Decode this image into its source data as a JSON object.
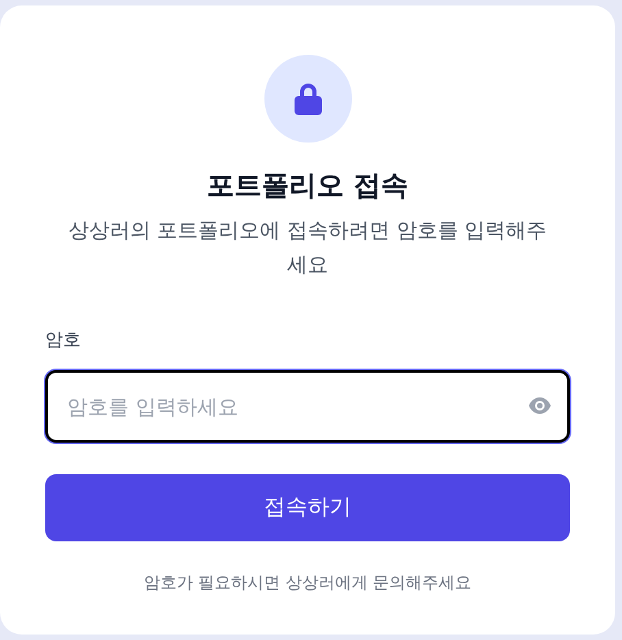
{
  "title": "포트폴리오 접속",
  "subtitle": "상상러의 포트폴리오에 접속하려면 암호를 입력해주세요",
  "password_field": {
    "label": "암호",
    "placeholder": "암호를 입력하세요",
    "focused": true
  },
  "submit_button": "접속하기",
  "help_text": "암호가 필요하시면 상상러에게 문의해주세요"
}
